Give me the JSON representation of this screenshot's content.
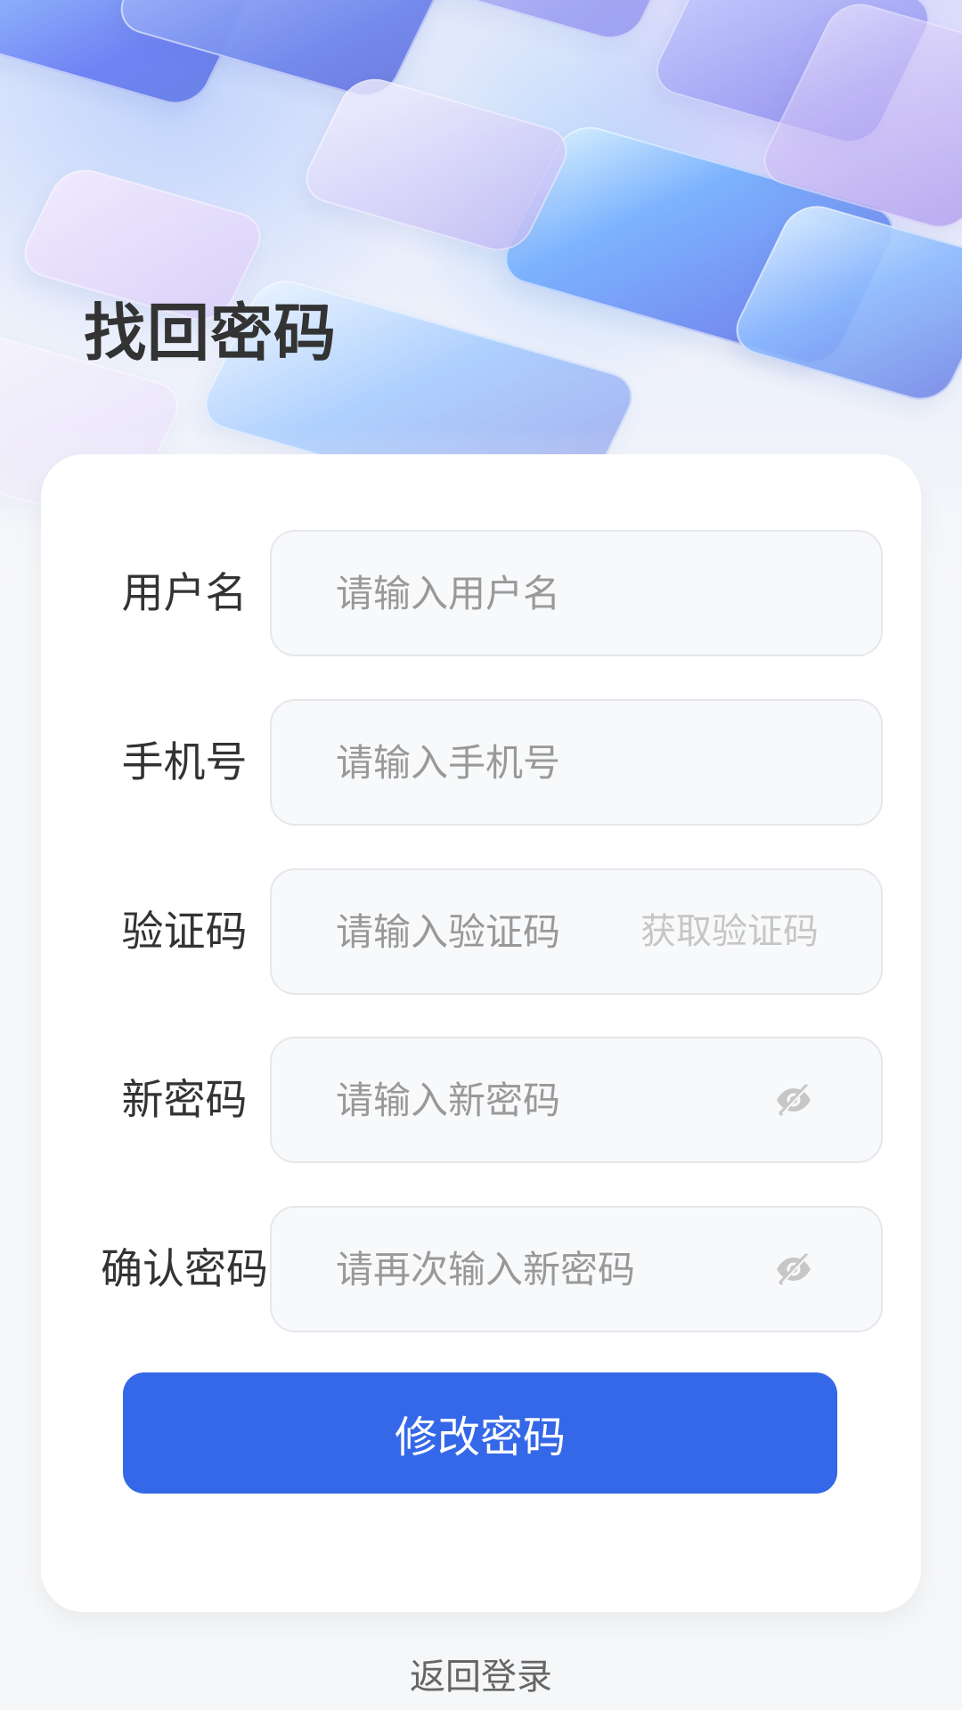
{
  "page": {
    "title": "找回密码",
    "back_login": "返回登录"
  },
  "form": {
    "fields": [
      {
        "label": "用户名",
        "placeholder": "请输入用户名"
      },
      {
        "label": "手机号",
        "placeholder": "请输入手机号"
      },
      {
        "label": "验证码",
        "placeholder": "请输入验证码",
        "action_label": "获取验证码"
      },
      {
        "label": "新密码",
        "placeholder": "请输入新密码",
        "icon": "eye-off-icon"
      },
      {
        "label": "确认密码",
        "placeholder": "请再次输入新密码",
        "icon": "eye-off-icon"
      }
    ],
    "submit_label": "修改密码"
  },
  "colors": {
    "primary": "#3568E8",
    "title": "#333333",
    "placeholder": "#999999",
    "secondary_action": "#C6C6C6",
    "background": "#F6F7F9"
  }
}
